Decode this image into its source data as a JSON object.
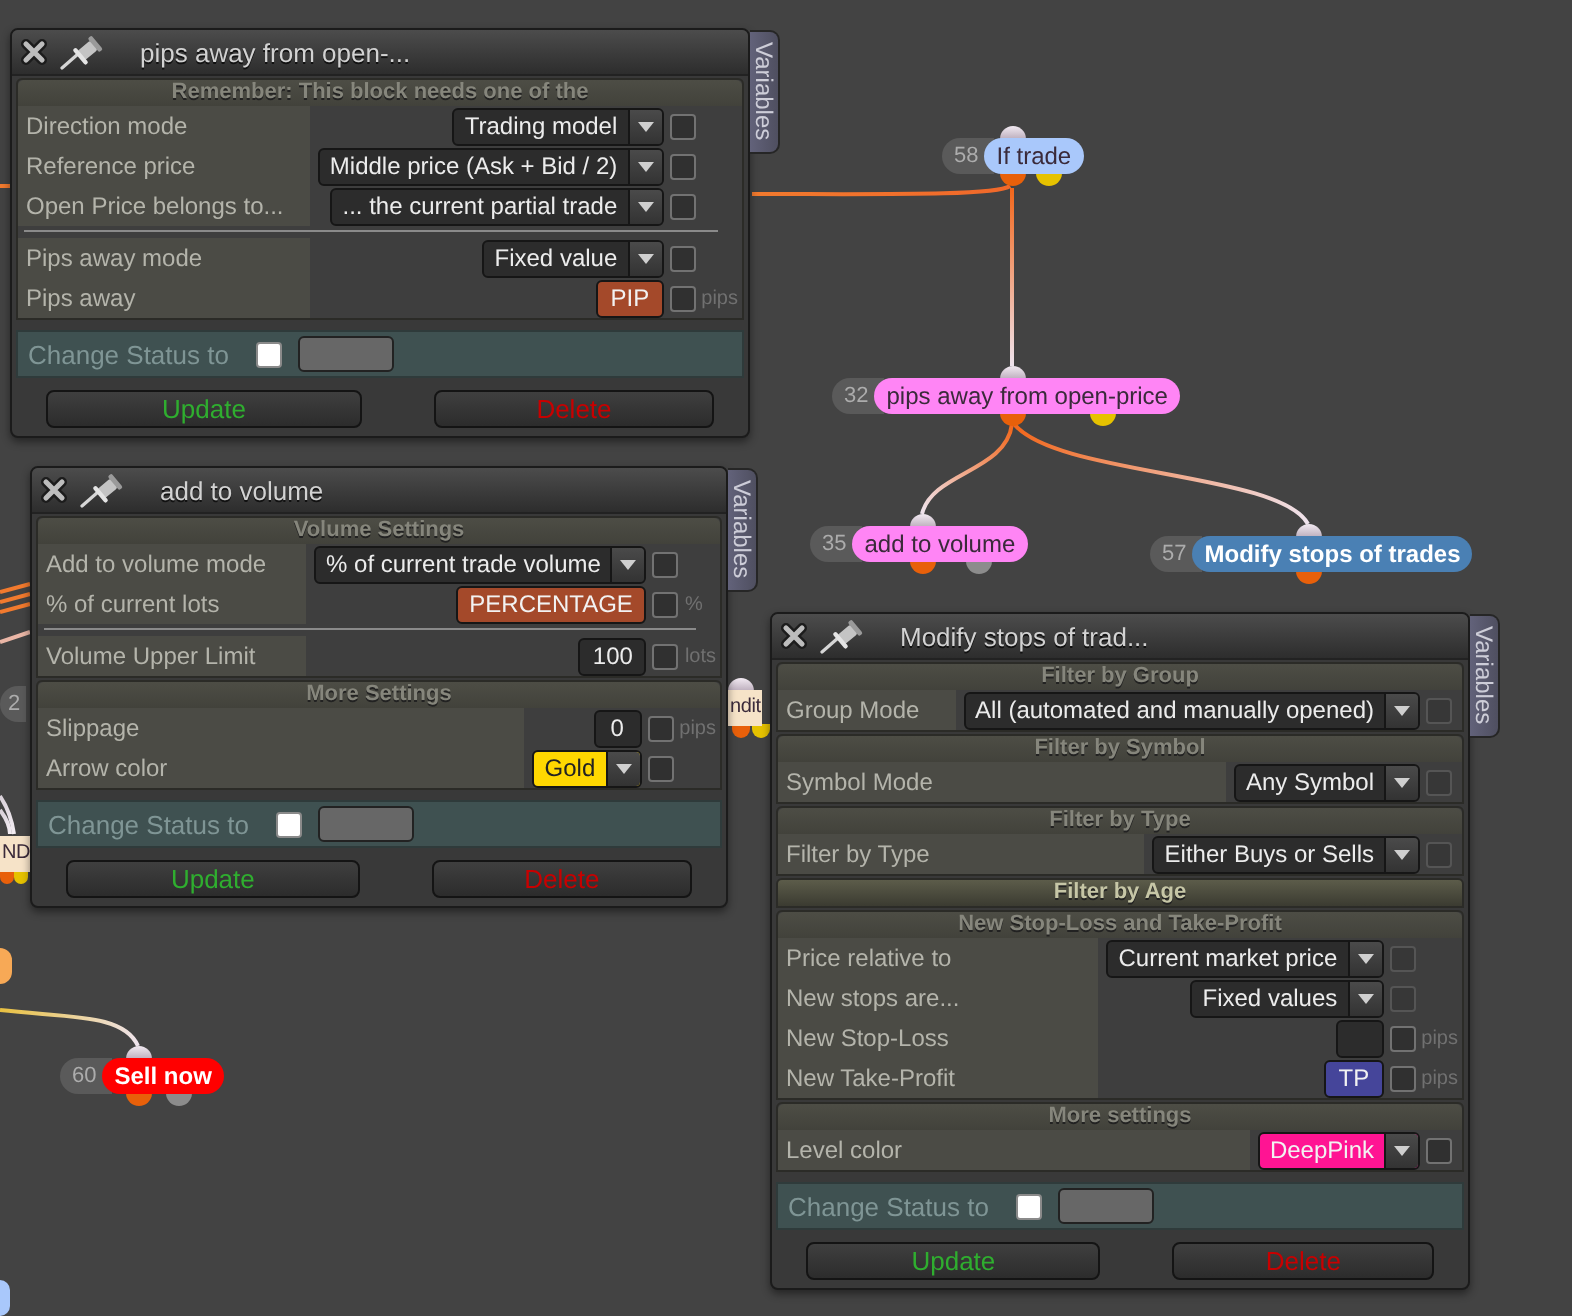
{
  "canvas": {
    "nodes": [
      {
        "number": "58",
        "label": "If trade",
        "color": "#a9c8fb",
        "ports": [
          {
            "color": "#e8600a"
          },
          {
            "color": "#e6c200"
          }
        ]
      },
      {
        "number": "32",
        "label": "pips away from open-price",
        "color": "#ff85f5",
        "ports": [
          {
            "color": "#e8600a"
          },
          {
            "color": "#e6c200"
          }
        ]
      },
      {
        "number": "35",
        "label": "add to volume",
        "color": "#ff85f5",
        "ports": [
          {
            "color": "#e8600a"
          },
          {
            "color": "#8c8c8c"
          }
        ]
      },
      {
        "number": "57",
        "label": "Modify stops of trades",
        "color": "#4a80b4",
        "ports": [
          {
            "color": "#e8600a"
          }
        ]
      },
      {
        "number": "60",
        "label": "Sell now",
        "color": "#ff0000",
        "ports": [
          {
            "color": "#e8600a"
          },
          {
            "color": "#8c8c8c"
          }
        ]
      },
      {
        "number": "2"
      },
      {
        "label": "ND",
        "color": "#f6e3c8",
        "ports": [
          {
            "color": "#e8600a"
          },
          {
            "color": "#e6c200"
          }
        ]
      },
      {
        "label": "ndit",
        "color": "#f6e3c8",
        "ports": [
          {
            "color": "#e8600a"
          },
          {
            "color": "#e6c200"
          }
        ]
      },
      {
        "color": "#f7a956"
      },
      {
        "color": "#a9c8fb"
      }
    ]
  },
  "windows": [
    {
      "title": "pips away from open-...",
      "tab": "Variables",
      "sections": [
        {
          "header": "Remember: This block needs one of the",
          "expanded": true,
          "rows": [
            {
              "kind": "dropdown",
              "label": "Direction mode",
              "value": "Trading model",
              "checked": false,
              "disabled": false
            },
            {
              "kind": "dropdown",
              "label": "Reference price",
              "value": "Middle price (Ask + Bid / 2)",
              "checked": false,
              "disabled": false
            },
            {
              "kind": "dropdown",
              "label": "Open Price belongs to...",
              "value": "... the current partial trade",
              "checked": false,
              "disabled": false
            },
            {
              "kind": "divider"
            },
            {
              "kind": "dropdown",
              "label": "Pips away mode",
              "value": "Fixed value",
              "checked": false,
              "disabled": false
            },
            {
              "kind": "input",
              "label": "Pips away",
              "value": "PIP",
              "color": "#a4492a",
              "checked": false,
              "disabled": false,
              "unit": "pips"
            }
          ]
        }
      ],
      "status": {
        "label": "Change Status to",
        "checked": false
      },
      "buttons": [
        {
          "kind": "update",
          "label": "Update"
        },
        {
          "kind": "delete",
          "label": "Delete"
        }
      ]
    },
    {
      "title": "add to volume",
      "tab": "Variables",
      "sections": [
        {
          "header": "Volume Settings",
          "expanded": true,
          "rows": [
            {
              "kind": "dropdown",
              "label": "Add to volume mode",
              "value": "% of current trade volume",
              "checked": false,
              "disabled": false
            },
            {
              "kind": "input",
              "label": "% of current lots",
              "value": "PERCENTAGE",
              "color": "#a4492a",
              "checked": false,
              "disabled": false,
              "unit": "%"
            },
            {
              "kind": "divider"
            },
            {
              "kind": "input",
              "label": "Volume Upper Limit",
              "value": "100",
              "checked": false,
              "disabled": false,
              "unit": "lots"
            }
          ]
        },
        {
          "header": "More Settings",
          "expanded": true,
          "rows": [
            {
              "kind": "input",
              "label": "Slippage",
              "value": "0",
              "checked": false,
              "disabled": false,
              "unit": "pips"
            },
            {
              "kind": "dropdown",
              "label": "Arrow color",
              "value": "Gold",
              "color": "#ffd700",
              "checked": false,
              "disabled": false
            }
          ]
        }
      ],
      "status": {
        "label": "Change Status to",
        "checked": false
      },
      "buttons": [
        {
          "kind": "update",
          "label": "Update"
        },
        {
          "kind": "delete",
          "label": "Delete"
        }
      ]
    },
    {
      "title": "Modify stops of trad...",
      "tab": "Variables",
      "sections": [
        {
          "header": "Filter by Group",
          "expanded": true,
          "rows": [
            {
              "kind": "dropdown",
              "label": "Group Mode",
              "value": "All (automated and manually opened)",
              "checked": false,
              "disabled": true
            }
          ]
        },
        {
          "header": "Filter by Symbol",
          "expanded": true,
          "rows": [
            {
              "kind": "dropdown",
              "label": "Symbol Mode",
              "value": "Any Symbol",
              "checked": false,
              "disabled": true
            }
          ]
        },
        {
          "header": "Filter by Type",
          "expanded": true,
          "rows": [
            {
              "kind": "dropdown",
              "label": "Filter by Type",
              "value": "Either Buys or Sells",
              "checked": false,
              "disabled": true
            }
          ]
        },
        {
          "header": "Filter by Age",
          "expanded": false
        },
        {
          "header": "New Stop-Loss and Take-Profit",
          "expanded": true,
          "rows": [
            {
              "kind": "dropdown",
              "label": "Price relative to",
              "value": "Current market price",
              "checked": false,
              "disabled": true
            },
            {
              "kind": "dropdown",
              "label": "New stops are...",
              "value": "Fixed values",
              "checked": false,
              "disabled": true
            },
            {
              "kind": "input",
              "label": "New Stop-Loss",
              "checked": false,
              "disabled": false,
              "unit": "pips"
            },
            {
              "kind": "input",
              "label": "New Take-Profit",
              "value": "TP",
              "color": "#45459a",
              "checked": false,
              "disabled": false,
              "unit": "pips"
            }
          ]
        },
        {
          "header": "More settings",
          "expanded": true,
          "rows": [
            {
              "kind": "dropdown",
              "label": "Level color",
              "value": "DeepPink",
              "color": "#ff1493",
              "checked": false,
              "disabled": false
            }
          ]
        }
      ],
      "status": {
        "label": "Change Status to",
        "checked": false
      },
      "buttons": [
        {
          "kind": "update",
          "label": "Update"
        },
        {
          "kind": "delete",
          "label": "Delete"
        }
      ]
    }
  ]
}
